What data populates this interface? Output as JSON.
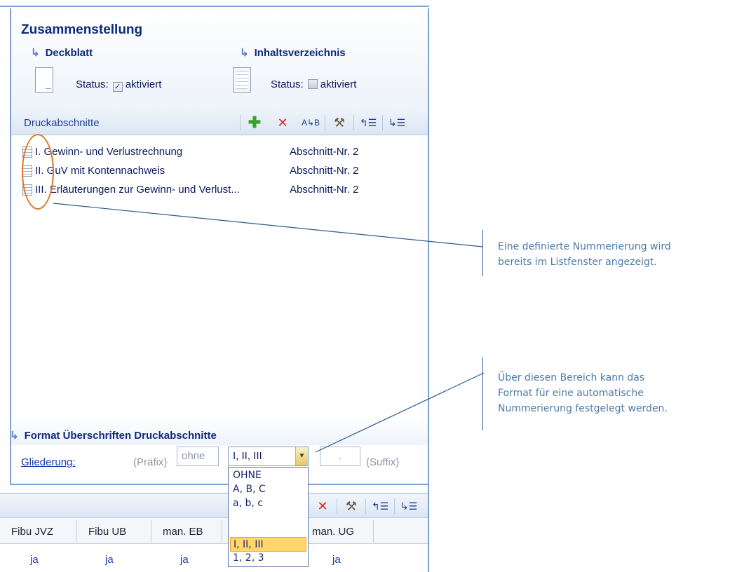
{
  "panel": {
    "title": "Zusammenstellung",
    "deckblatt": {
      "label": "Deckblatt",
      "status_label": "Status:",
      "checkbox_label": "aktiviert",
      "checked": true
    },
    "inhaltsverzeichnis": {
      "label": "Inhaltsverzeichnis",
      "status_label": "Status:",
      "checkbox_label": "aktiviert",
      "checked": false
    },
    "section_label": "Druckabschnitte",
    "toolbar_icons": [
      "add-icon",
      "delete-icon",
      "sort-icon",
      "tools-icon",
      "move-up-icon",
      "move-down-icon"
    ],
    "rows": [
      {
        "name": "I. Gewinn- und Verlustrechnung",
        "nr": "Abschnitt-Nr. 2"
      },
      {
        "name": "II. GuV mit Kontennachweis",
        "nr": "Abschnitt-Nr. 2"
      },
      {
        "name": "III. Erläuterungen zur Gewinn- und Verlust...",
        "nr": "Abschnitt-Nr. 2"
      }
    ]
  },
  "format": {
    "title": "Format Überschriften Druckabschnitte",
    "gliederung_label": "Gliederung:",
    "praefix_label": "(Präfix)",
    "praefix_value": "ohne",
    "selected": "I, II, III",
    "separator_value": ".",
    "suffix_label": "(Suffix)",
    "options": [
      "OHNE",
      "A, B, C",
      "a, b, c",
      "I, II, III",
      "1, 2, 3"
    ]
  },
  "lower": {
    "columns": [
      "Fibu JVZ",
      "Fibu UB",
      "man. EB",
      "man. UG"
    ],
    "values": [
      "ja",
      "ja",
      "ja",
      "ja",
      "ja"
    ]
  },
  "annotations": {
    "note1_line1": "Eine definierte Nummerierung wird",
    "note1_line2": "bereits im Listfenster angezeigt.",
    "note2_line1": "Über diesen Bereich kann das",
    "note2_line2": "Format für eine automatische",
    "note2_line3": "Nummerierung festgelegt werden."
  },
  "colors": {
    "accent": "#0d2a7a",
    "border": "#7fa1cf",
    "highlight": "#ffd76a",
    "annotation": "#e0761f"
  }
}
